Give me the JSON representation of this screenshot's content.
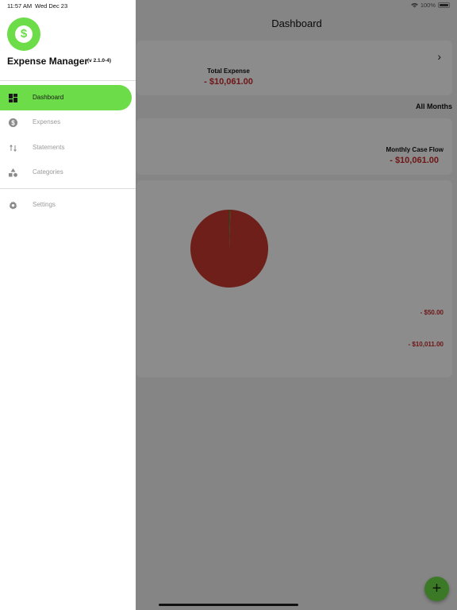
{
  "status_bar": {
    "time": "11:57 AM",
    "date": "Wed Dec 23",
    "battery": "100%"
  },
  "drawer": {
    "app_name": "Expense Manager",
    "version": "(v 2.1.0-4)",
    "nav_items": [
      {
        "label": "Dashboard",
        "icon": "dashboard-icon",
        "active": true
      },
      {
        "label": "Expenses",
        "icon": "dollar-icon",
        "active": false
      },
      {
        "label": "Statements",
        "icon": "swap-vertical-icon",
        "active": false
      },
      {
        "label": "Categories",
        "icon": "shapes-icon",
        "active": false
      },
      {
        "label": "Settings",
        "icon": "gear-icon",
        "active": false
      }
    ]
  },
  "dashboard": {
    "title": "Dashboard",
    "total_expense_label": "Total Expense",
    "total_expense_value": "- $10,061.00",
    "filter": "All Months",
    "cash_flow_label": "Monthly Case Flow",
    "cash_flow_value": "- $10,061.00",
    "legend_values": [
      "- $50.00",
      "- $10,011.00"
    ]
  },
  "chart_data": {
    "type": "pie",
    "values": [
      50,
      10011
    ],
    "colors": [
      "#3f8f2c",
      "#c83a30"
    ]
  },
  "colors": {
    "accent": "#6cdc48",
    "negative": "#c92a2a"
  }
}
